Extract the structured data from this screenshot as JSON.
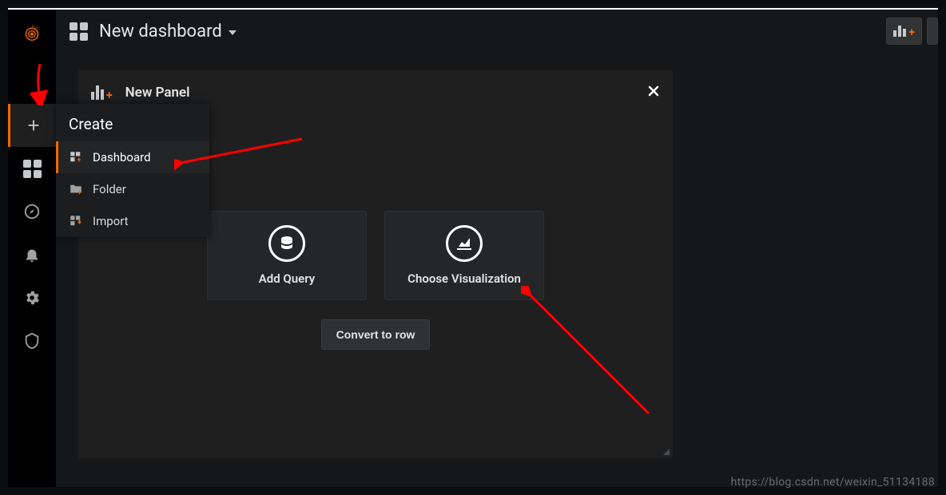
{
  "header": {
    "title": "New dashboard"
  },
  "panel": {
    "title": "New Panel",
    "actions": {
      "add_query": "Add Query",
      "choose_viz": "Choose Visualization",
      "convert_row": "Convert to row"
    }
  },
  "flyout": {
    "title": "Create",
    "items": {
      "dashboard": "Dashboard",
      "folder": "Folder",
      "import": "Import"
    }
  },
  "watermark": "https://blog.csdn.net/weixin_51134188"
}
